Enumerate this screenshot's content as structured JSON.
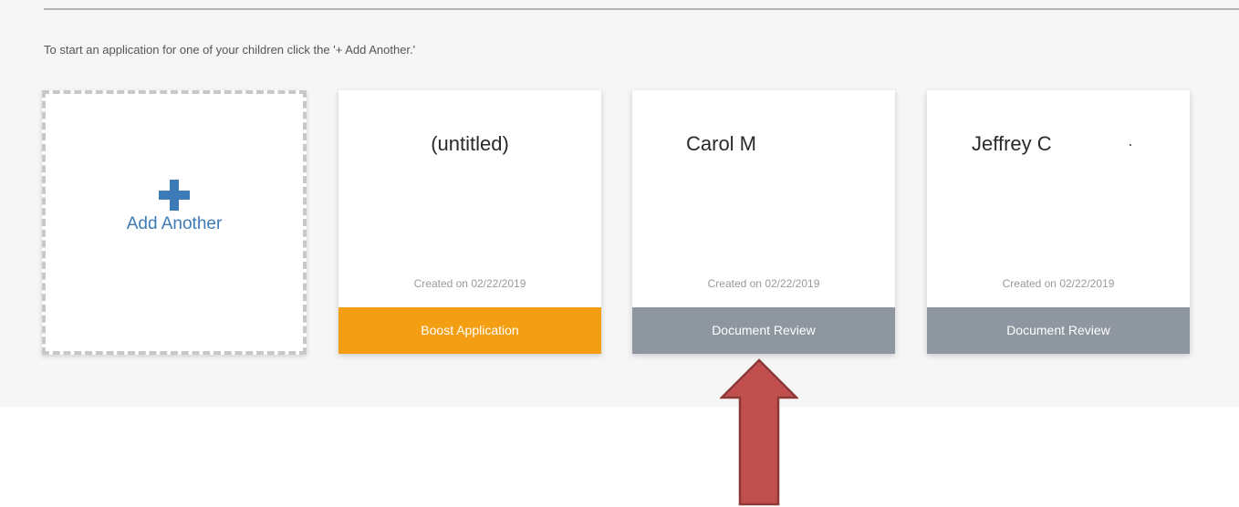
{
  "instructions": "To start an application for one of your children click the '+ Add Another.'",
  "add_card": {
    "label": "Add Another",
    "icon": "plus-icon",
    "accent_color": "#3d7ab8"
  },
  "cards": [
    {
      "name": "(untitled)",
      "created": "Created on 02/22/2019",
      "action": "Boost Application",
      "action_color": "#f49e13"
    },
    {
      "name": "Carol M",
      "created": "Created on 02/22/2019",
      "action": "Document Review",
      "action_color": "#8e969f"
    },
    {
      "name": "Jeffrey C",
      "created": "Created on 02/22/2019",
      "action": "Document Review",
      "action_color": "#8e969f"
    }
  ],
  "annotation": {
    "icon": "up-arrow-icon",
    "fill_color": "#c0504d",
    "stroke_color": "#8c3836"
  }
}
